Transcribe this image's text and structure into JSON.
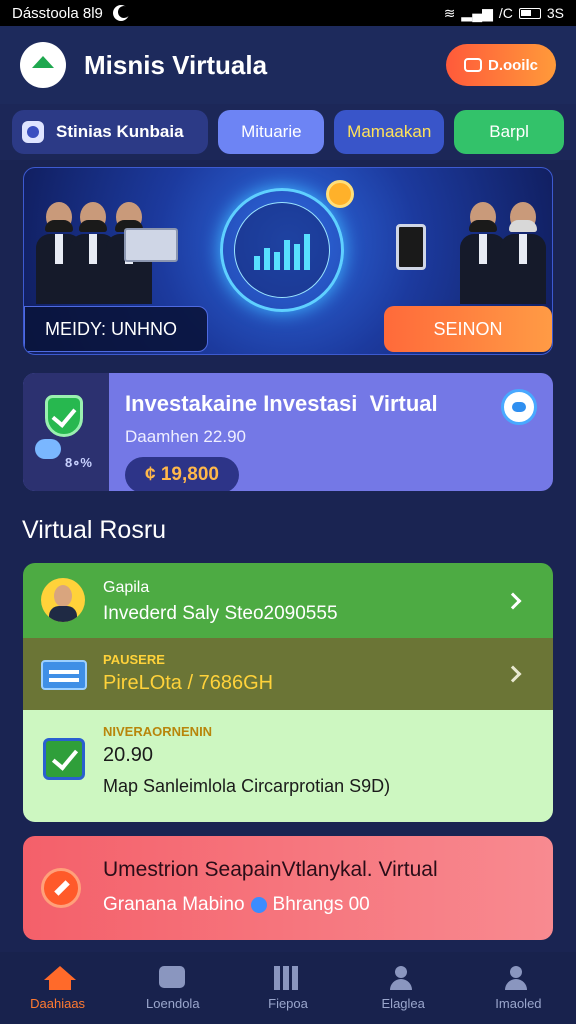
{
  "status_bar": {
    "left_text": "Dásstoola 8l9",
    "right_text": "/C",
    "right_text_2": "3S"
  },
  "header": {
    "title": "Misnis Virtuala",
    "action_label": "D.ooilc"
  },
  "tabs": [
    {
      "label": "Stinias Kunbaia"
    },
    {
      "label": "Mituarie"
    },
    {
      "label": "Mamaakan"
    },
    {
      "label": "Barpl"
    }
  ],
  "banner": {
    "label": "MEIDY: UNHNO",
    "button": "SEINON"
  },
  "invest_card": {
    "left_text": "8∘%",
    "title": "Investakaine Investasi  Virtual",
    "subtitle": "Daamhen 22.90",
    "amount": "¢ 19,800"
  },
  "section_title": "Virtual Rosru",
  "list": {
    "row1": {
      "small": "Gapila",
      "big": "Invederd Saly Steo2090555"
    },
    "row2": {
      "small": "PAUSERE",
      "big": "PireLOta / 7686GH"
    },
    "row3": {
      "small": "NIVERAORNENIN",
      "value": "20.90",
      "text": "Map Sanleimlola Circarprotian S9D)"
    }
  },
  "alert": {
    "title": "Umestrion SeapainVtlanykal. Virtual",
    "sub_a": "Granana Mabino",
    "sub_b": "Bhrangs 00"
  },
  "bottom_nav": [
    {
      "label": "Daahiaas",
      "icon": "home-icon"
    },
    {
      "label": "Loendola",
      "icon": "bus-icon"
    },
    {
      "label": "Fiepoa",
      "icon": "grid-icon"
    },
    {
      "label": "Elaglea",
      "icon": "user-icon"
    },
    {
      "label": "Imaoled",
      "icon": "profile-icon"
    }
  ],
  "colors": {
    "accent": "#ff7a30",
    "background": "#1a2452",
    "banner_button": "#ff8a40"
  }
}
